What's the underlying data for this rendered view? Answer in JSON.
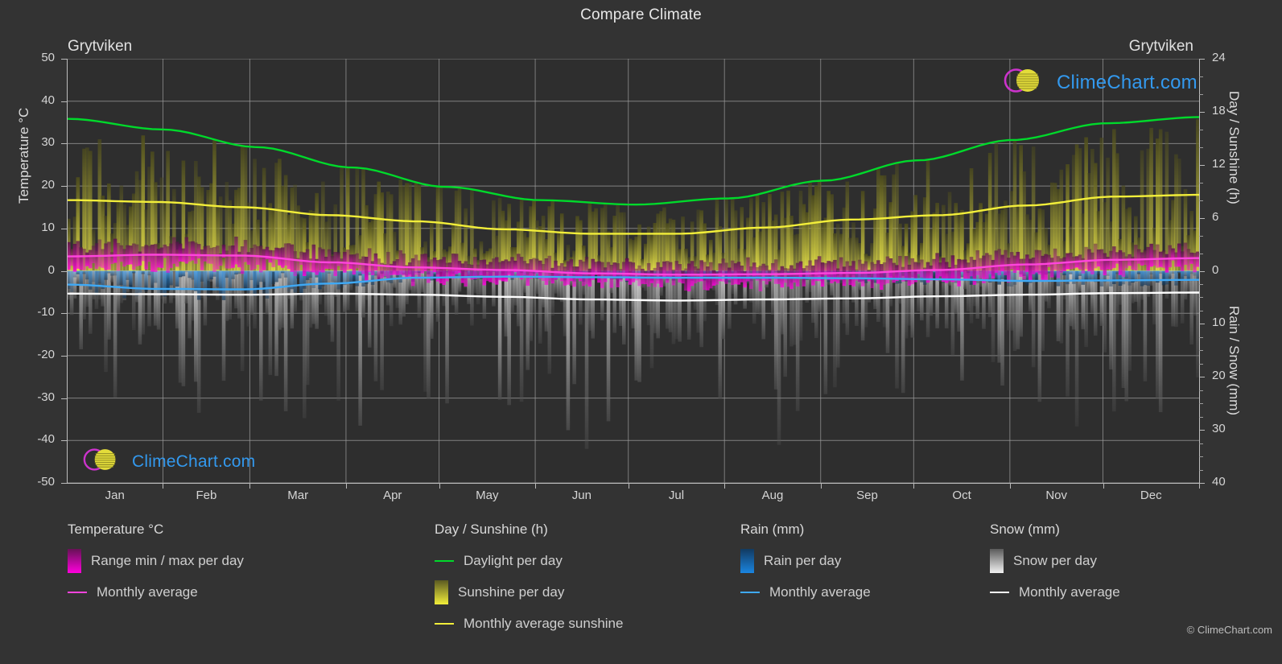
{
  "header": {
    "title": "Compare Climate",
    "location_left": "Grytviken",
    "location_right": "Grytviken"
  },
  "footer": {
    "copyright": "© ClimeChart.com"
  },
  "branding": {
    "wordmark": "ClimeChart.com",
    "logo_arc_color": "#cc33cc",
    "logo_sphere_color": "#e8e23c",
    "wordmark_color": "#3399ee"
  },
  "legend": {
    "groups": [
      {
        "title": "Temperature °C",
        "items": [
          {
            "label": "Range min / max per day",
            "style": "box",
            "color": "#ff00dd",
            "color2": "#661155"
          },
          {
            "label": "Monthly average",
            "style": "line",
            "color": "#ff44dd"
          }
        ]
      },
      {
        "title": "Day / Sunshine (h)",
        "items": [
          {
            "label": "Daylight per day",
            "style": "line",
            "color": "#00d92b"
          },
          {
            "label": "Sunshine per day",
            "style": "box",
            "color": "#f2ee3a",
            "color2": "#5b5a22"
          },
          {
            "label": "Monthly average sunshine",
            "style": "line",
            "color": "#f2ee3a"
          }
        ]
      },
      {
        "title": "Rain (mm)",
        "items": [
          {
            "label": "Rain per day",
            "style": "box",
            "color": "#1a85e0",
            "color2": "#123a60"
          },
          {
            "label": "Monthly average",
            "style": "line",
            "color": "#3fa9f5"
          }
        ]
      },
      {
        "title": "Snow (mm)",
        "items": [
          {
            "label": "Snow per day",
            "style": "box",
            "color": "#f2f2f2",
            "color2": "#5a5a5a"
          },
          {
            "label": "Monthly average",
            "style": "line",
            "color": "#ffffff"
          }
        ]
      }
    ]
  },
  "chart_data": {
    "type": "line",
    "title": "Compare Climate",
    "location": "Grytviken",
    "grid": true,
    "xlabel": "",
    "x_categories": [
      "Jan",
      "Feb",
      "Mar",
      "Apr",
      "May",
      "Jun",
      "Jul",
      "Aug",
      "Sep",
      "Oct",
      "Nov",
      "Dec"
    ],
    "axes": {
      "left": {
        "label": "Temperature °C",
        "ticks": [
          50,
          40,
          30,
          20,
          10,
          0,
          -10,
          -20,
          -30,
          -40,
          -50
        ],
        "range": [
          -50,
          50
        ]
      },
      "right_top": {
        "label": "Day / Sunshine (h)",
        "ticks": [
          24,
          18,
          12,
          6,
          0
        ],
        "range": [
          0,
          24
        ],
        "note": "0 h aligns with 0 °C; 24 h aligns with 50 °C"
      },
      "right_bottom": {
        "label": "Rain / Snow (mm)",
        "ticks": [
          0,
          10,
          20,
          30,
          40
        ],
        "range": [
          0,
          40
        ],
        "note": "0 mm aligns with 0 °C; 40 mm aligns with -50 °C"
      }
    },
    "series": [
      {
        "name": "Daylight per day",
        "unit": "h",
        "axis": "right_top",
        "color": "#00d92b",
        "values": [
          17.2,
          16.0,
          14.0,
          11.7,
          9.5,
          8.0,
          7.5,
          8.2,
          10.2,
          12.5,
          14.8,
          16.7,
          17.4
        ]
      },
      {
        "name": "Monthly average sunshine",
        "unit": "h",
        "axis": "right_top",
        "color": "#f2ee3a",
        "values": [
          8.0,
          7.8,
          7.2,
          6.3,
          5.6,
          4.7,
          4.2,
          4.2,
          4.9,
          5.8,
          6.3,
          7.4,
          8.4,
          8.6
        ]
      },
      {
        "name": "Temperature monthly average",
        "unit": "°C",
        "axis": "left",
        "color": "#ff44dd",
        "values": [
          3.4,
          3.8,
          3.6,
          2.0,
          0.8,
          0.2,
          -0.6,
          -0.9,
          -0.8,
          -0.5,
          0.2,
          1.5,
          2.6,
          3.0
        ]
      },
      {
        "name": "Rain monthly average",
        "unit": "mm",
        "axis": "right_bottom",
        "color": "#3fa9f5",
        "values": [
          2.6,
          3.4,
          3.5,
          2.4,
          1.3,
          1.1,
          1.2,
          1.3,
          1.3,
          1.4,
          1.6,
          1.9,
          1.8,
          1.7
        ]
      },
      {
        "name": "Snow monthly average",
        "unit": "mm",
        "axis": "right_bottom",
        "color": "#ffffff",
        "values": [
          4.3,
          4.4,
          4.5,
          4.3,
          4.5,
          4.9,
          5.4,
          5.6,
          5.4,
          5.2,
          4.8,
          4.5,
          4.2,
          4.1
        ]
      }
    ],
    "daily_bands": [
      {
        "name": "Sunshine per day",
        "color": "#b3ad3c",
        "axis": "right_top",
        "desc": "vertical bars from 0 h upward, peak ~14 h in summer"
      },
      {
        "name": "Temperature range min / max per day",
        "color": "#ff00dd",
        "axis": "left",
        "desc": "vertical bars spanning daily min to max around 0 °C"
      },
      {
        "name": "Rain per day",
        "color": "#1a85e0",
        "axis": "right_bottom",
        "desc": "vertical bars hanging below 0 mm, up to ~8 mm"
      },
      {
        "name": "Snow per day",
        "color": "#dddddd",
        "axis": "right_bottom",
        "desc": "vertical bars hanging below 0 mm, up to ~40 mm"
      }
    ]
  }
}
